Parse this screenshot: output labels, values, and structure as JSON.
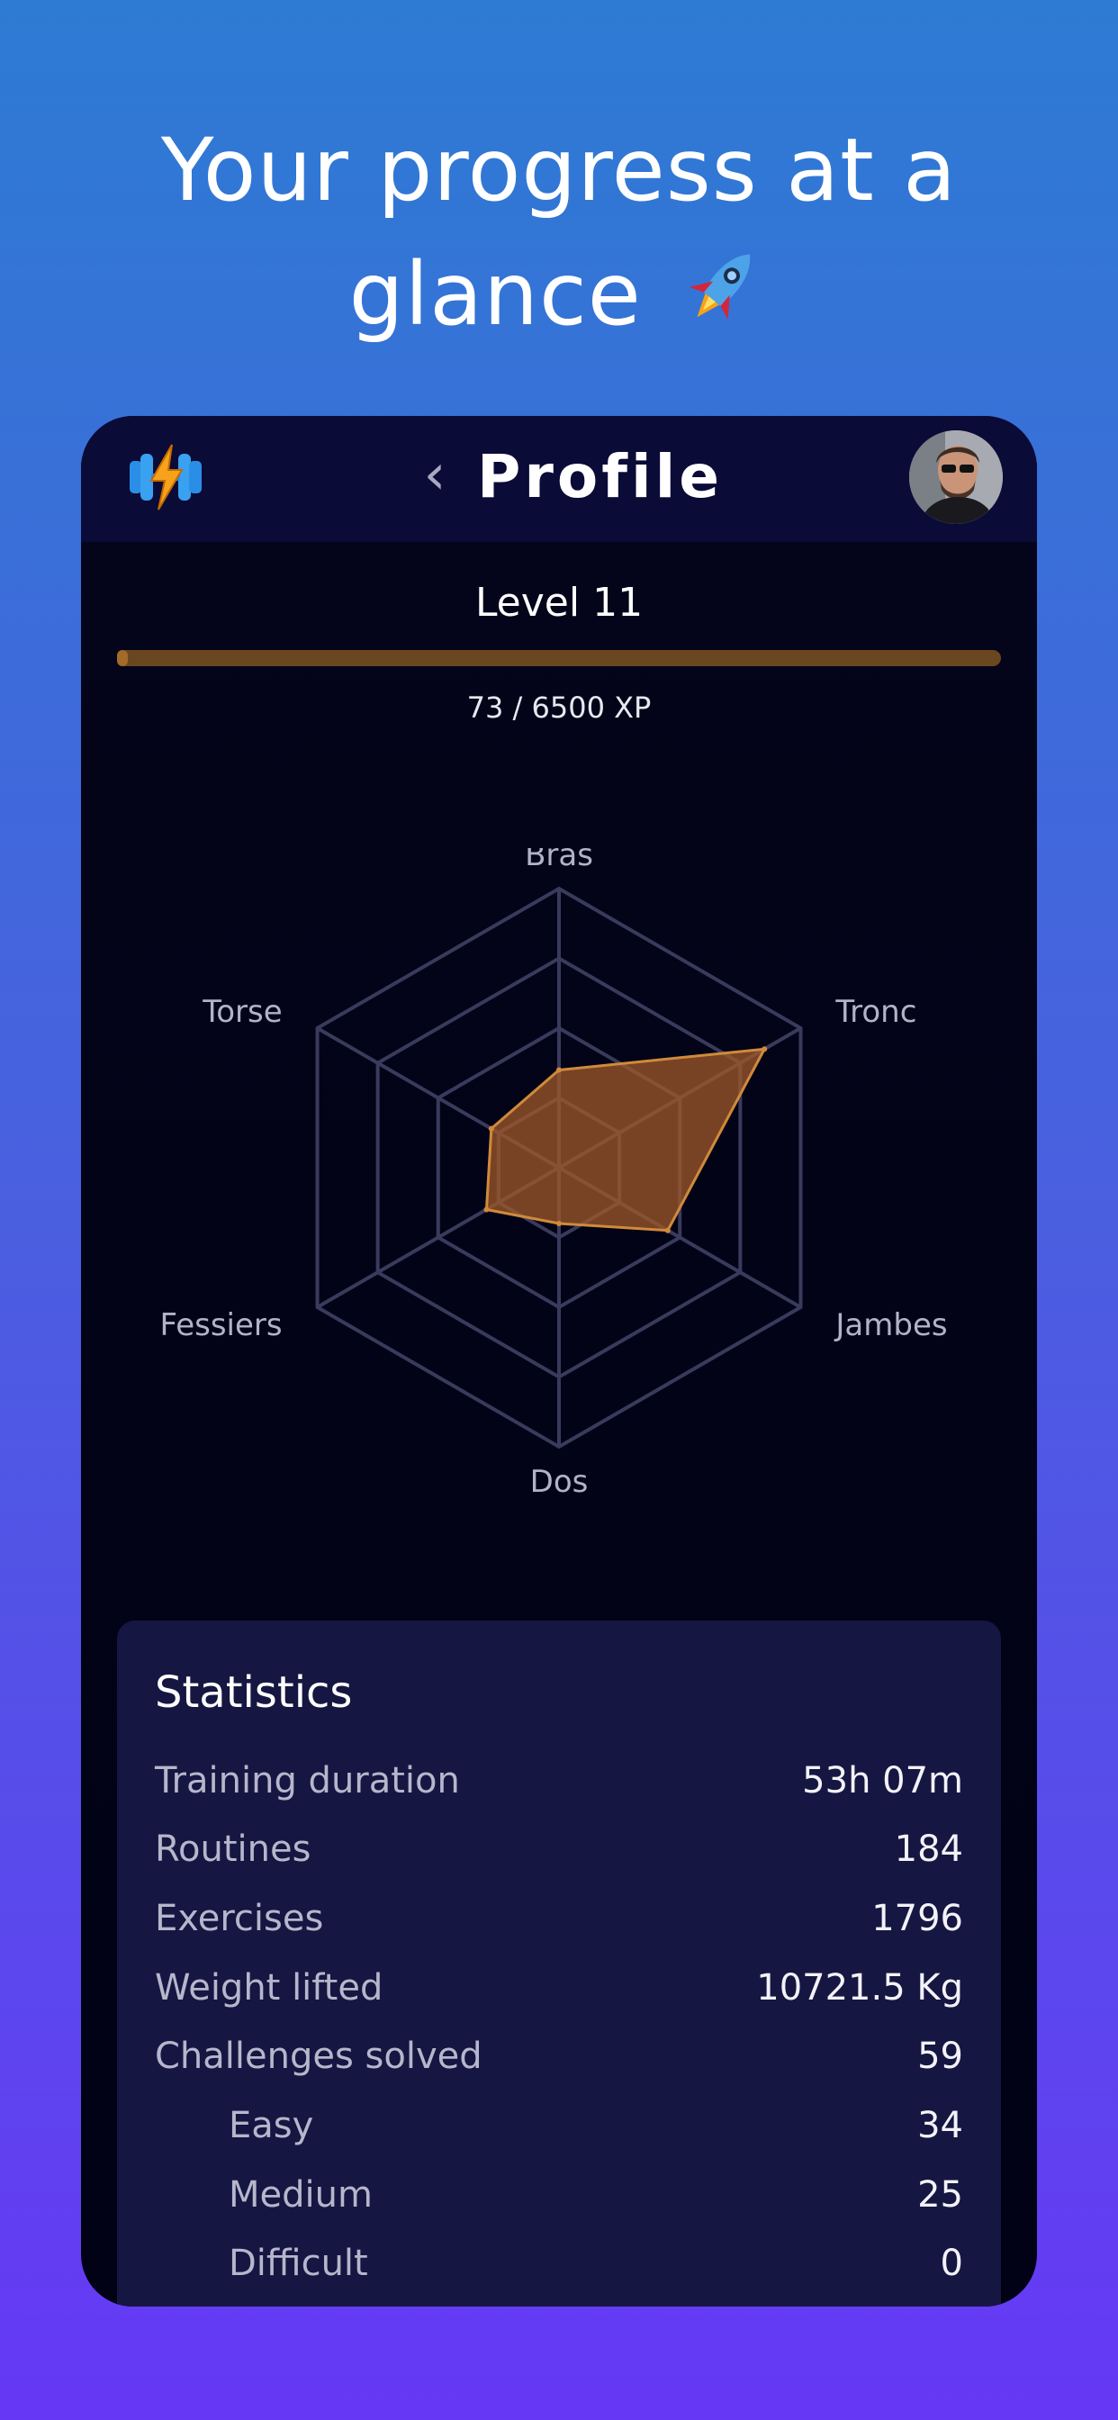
{
  "headline": {
    "line1": "Your progress at a",
    "line2": "glance",
    "emoji_icon": "rocket-icon"
  },
  "header": {
    "title": "Profile",
    "logo_icon": "dumbbell-lightning-icon",
    "back_icon": "chevron-left-icon",
    "avatar_icon": "user-avatar"
  },
  "level": {
    "label": "Level 11",
    "xp_text": "73 / 6500 XP",
    "xp_fraction": 0.0112
  },
  "radar": {
    "axes": [
      "Bras",
      "Tronc",
      "Jambes",
      "Dos",
      "Fessiers",
      "Torse"
    ],
    "values": [
      0.35,
      0.85,
      0.45,
      0.2,
      0.3,
      0.28
    ],
    "fill_color": "#a05a28",
    "stroke_color": "#d08a3a"
  },
  "stats": {
    "title": "Statistics",
    "rows": [
      {
        "label": "Training duration",
        "value": "53h 07m"
      },
      {
        "label": "Routines",
        "value": "184"
      },
      {
        "label": "Exercises",
        "value": "1796"
      },
      {
        "label": "Weight lifted",
        "value": "10721.5 Kg"
      },
      {
        "label": "Challenges solved",
        "value": "59"
      },
      {
        "label": "Easy",
        "value": "34"
      },
      {
        "label": "Medium",
        "value": "25"
      },
      {
        "label": "Difficult",
        "value": "0"
      }
    ]
  },
  "colors": {
    "accent": "#a36a28",
    "card": "#161642",
    "topbar": "#0b0b38"
  }
}
